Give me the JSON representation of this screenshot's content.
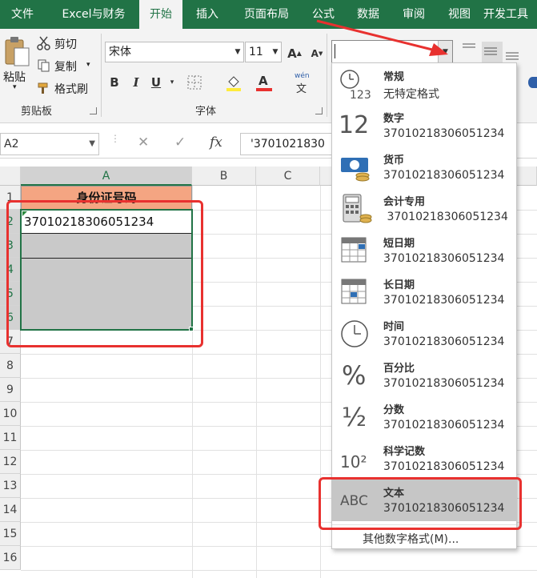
{
  "tabs": [
    "文件",
    "Excel与财务",
    "开始",
    "插入",
    "页面布局",
    "公式",
    "数据",
    "审阅",
    "视图",
    "开发工具"
  ],
  "clipboard": {
    "paste": "粘贴",
    "paste_arrow": "▾",
    "cut": "剪切",
    "copy": "复制",
    "copy_arrow": "▾",
    "format_painter": "格式刷",
    "group_label": "剪贴板"
  },
  "font": {
    "name": "宋体",
    "size": "11",
    "bold": "B",
    "italic": "I",
    "underline": "U",
    "grow": "A",
    "shrink": "A",
    "font_color_letter": "A",
    "phonetic_top": "wén",
    "phonetic_bottom": "文",
    "group_label": "字体"
  },
  "number": {
    "format_value": ""
  },
  "formula_bar": {
    "name_box": "A2",
    "fx": "fx",
    "cancel": "✕",
    "enter": "✓",
    "formula": "'3701021830"
  },
  "grid": {
    "columns": [
      "A",
      "B",
      "C"
    ],
    "rows": [
      "1",
      "2",
      "3",
      "4",
      "5",
      "6",
      "7",
      "8",
      "9",
      "10",
      "11",
      "12",
      "13",
      "14",
      "15",
      "16"
    ],
    "a1": "身份证号码",
    "a2": "37010218306051234"
  },
  "number_formats": [
    {
      "name": "常规",
      "sample": "无特定格式",
      "icon": "clock-123-icon"
    },
    {
      "name": "数字",
      "sample": "37010218306051234",
      "icon": "number-12-icon",
      "glyph": "12"
    },
    {
      "name": "货币",
      "sample": "37010218306051234",
      "icon": "currency-icon"
    },
    {
      "name": "会计专用",
      "sample": " 37010218306051234",
      "icon": "calculator-icon"
    },
    {
      "name": "短日期",
      "sample": "37010218306051234",
      "icon": "calendar-icon"
    },
    {
      "name": "长日期",
      "sample": "37010218306051234",
      "icon": "calendar-icon"
    },
    {
      "name": "时间",
      "sample": "37010218306051234",
      "icon": "clock-icon"
    },
    {
      "name": "百分比",
      "sample": "37010218306051234",
      "icon": "percent-icon",
      "glyph": "%"
    },
    {
      "name": "分数",
      "sample": "37010218306051234",
      "icon": "fraction-icon",
      "glyph": "½"
    },
    {
      "name": "科学记数",
      "sample": "37010218306051234",
      "icon": "scientific-icon",
      "glyph": "10²"
    },
    {
      "name": "文本",
      "sample": "37010218306051234",
      "icon": "text-abc-icon",
      "glyph": "ABC"
    }
  ],
  "more_formats": "其他数字格式(M)...",
  "colors": {
    "accent": "#217346",
    "header_fill": "#f4a582",
    "highlight": "#e8312f",
    "selection": "#c6c6c6"
  }
}
